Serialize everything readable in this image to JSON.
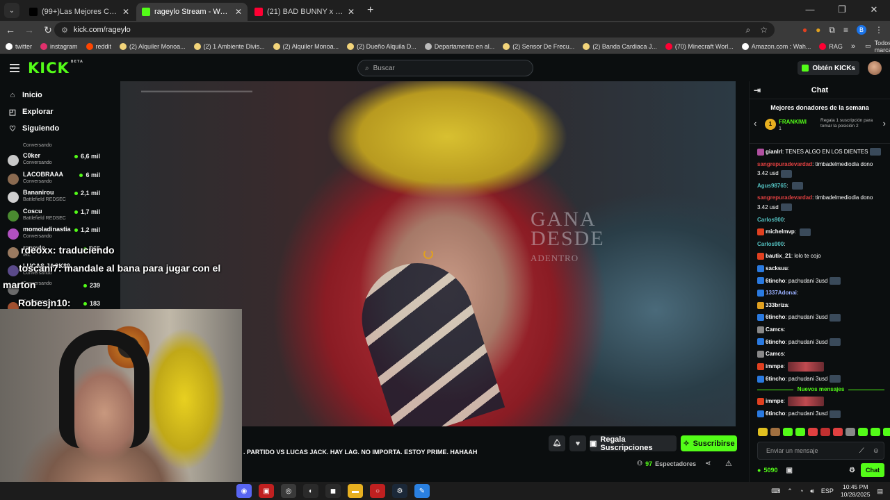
{
  "browser": {
    "tabs": [
      {
        "title": "(99+)Las Mejores Canciones Rá",
        "active": false,
        "favicon_color": "#000000"
      },
      {
        "title": "rageylo Stream - Watch Live",
        "active": true,
        "favicon_color": "#53fc18"
      },
      {
        "title": "(21) BAD BUNNY x JOWELL & R",
        "active": false,
        "favicon_color": "#ff0033"
      }
    ],
    "url": "kick.com/rageylo",
    "profile_initial": "B",
    "bookmarks": [
      {
        "label": "twitter",
        "color": "#ffffff"
      },
      {
        "label": "instagram",
        "color": "#e1306c"
      },
      {
        "label": "reddit",
        "color": "#ff4500"
      },
      {
        "label": "(2) Alquiler Monoa...",
        "color": "#f2d47a"
      },
      {
        "label": "(2) 1 Ambiente Divis...",
        "color": "#f2d47a"
      },
      {
        "label": "(2) Alquiler Monoa...",
        "color": "#f2d47a"
      },
      {
        "label": "(2) Dueño Alquila D...",
        "color": "#f2d47a"
      },
      {
        "label": "Departamento en al...",
        "color": "#bbbbbb"
      },
      {
        "label": "(2) Sensor De Frecu...",
        "color": "#f2d47a"
      },
      {
        "label": "(2) Banda Cardiaca J...",
        "color": "#f2d47a"
      },
      {
        "label": "(70) Minecraft Worl...",
        "color": "#ff0033"
      },
      {
        "label": "Amazon.com : Wah...",
        "color": "#ffffff"
      },
      {
        "label": "RAG",
        "color": "#ff0033"
      }
    ],
    "bookmarks_more": "»",
    "all_bookmarks": "Todos los marcadores"
  },
  "kick": {
    "logo": "KICK",
    "logo_sup": "BETA",
    "search_placeholder": "Buscar",
    "get_kicks": "Obtén KICKs",
    "accent": "#53fc18"
  },
  "sidebar": {
    "nav": [
      {
        "label": "Inicio",
        "icon": "home-icon",
        "glyph": "⌂"
      },
      {
        "label": "Explorar",
        "icon": "compass-icon",
        "glyph": "◰"
      },
      {
        "label": "Siguiendo",
        "icon": "heart-icon",
        "glyph": "♡"
      }
    ],
    "first_game": "Conversando",
    "channels": [
      {
        "name": "C0ker",
        "game": "Conversando",
        "viewers": "6,6 mil",
        "color": "#c8c8c8"
      },
      {
        "name": "LACOBRAAA",
        "game": "Conversando",
        "viewers": "6 mil",
        "color": "#8a6a50"
      },
      {
        "name": "Bananirou",
        "game": "Battlefield REDSEC",
        "viewers": "2,1 mil",
        "color": "#d0d0d0"
      },
      {
        "name": "Coscu",
        "game": "Battlefield REDSEC",
        "viewers": "1,7 mil",
        "color": "#4a8a30"
      },
      {
        "name": "momoladinastia",
        "game": "Conversando",
        "viewers": "1,2 mil",
        "color": "#b050c0"
      },
      {
        "name": "rageylo",
        "game": "IRL",
        "viewers": "965",
        "color": "#9a7a60"
      },
      {
        "name": "LUCAS JACK89",
        "game": "Conversando",
        "viewers": "",
        "color": "#5a4a8a"
      },
      {
        "name": "",
        "game": "Conversando",
        "viewers": "239",
        "color": "#6a6a6a"
      },
      {
        "name": "",
        "game": "Conversando",
        "viewers": "183",
        "color": "#a05030"
      }
    ]
  },
  "overlay": {
    "line1_user": "rdeoxx",
    "line1_text": ": traduciendo",
    "line2_user": "toscani7",
    "line2_text": ": mandale al bana para jugar con el",
    "line3": "marton",
    "line4_user": "Robesjn10",
    "line4_text": ":"
  },
  "stream": {
    "title": ". PARTIDO VS LUCAS JACK. HAY LAG. NO IMPORTA. ESTOY PRIME. HAHAAH",
    "gift_label": "Regala Suscripciones",
    "subscribe_label": "Suscribirse",
    "viewers": "97",
    "viewers_label": "Espectadores",
    "sign_line1": "GANA",
    "sign_line2": "DESDE",
    "sign_line3": "ADENTRO"
  },
  "chat": {
    "title": "Chat",
    "donors_title": "Mejores donadores de la semana",
    "top_donor": {
      "rank": "1",
      "name": "FRANKIWI",
      "count": "1"
    },
    "donor_cta": "Regala 1 suscripción para tomar la posición 2",
    "messages": [
      {
        "user": "gianlrl",
        "color": "#ffffff",
        "text": "TENES ALGO EN LOS DIENTES",
        "emote": "small",
        "badge": "#b050a0"
      },
      {
        "user": "sangrepuradevardad",
        "color": "#e04040",
        "text": "timbadelmediodia dono 3.42 usd",
        "emote": "small",
        "badge": ""
      },
      {
        "user": "Agus98765",
        "color": "#53c0c0",
        "text": "",
        "emote": "small",
        "badge": ""
      },
      {
        "user": "sangrepuradevardad",
        "color": "#e04040",
        "text": "timbadelmediodia dono 3.42 usd",
        "emote": "small",
        "badge": ""
      },
      {
        "user": "Carlos900",
        "color": "#53c0c0",
        "text": "",
        "emote": "",
        "badge": ""
      },
      {
        "user": "michelmvp",
        "color": "#ffffff",
        "text": "",
        "emote": "small",
        "badge": "#e04020"
      },
      {
        "user": "Carlos900",
        "color": "#53c0c0",
        "text": "",
        "emote": "",
        "badge": ""
      },
      {
        "user": "bautix_21",
        "color": "#ffffff",
        "text": "lolo te cojo",
        "emote": "",
        "badge": "#e04020"
      },
      {
        "user": "sacksuu",
        "color": "#ffffff",
        "text": "",
        "emote": "",
        "badge": "#2a7ae0"
      },
      {
        "user": "6tincho",
        "color": "#ffffff",
        "text": "pachudani 3usd",
        "emote": "small",
        "badge": "#2a7ae0"
      },
      {
        "user": "1337Adonai",
        "color": "#9ab0ff",
        "text": "",
        "emote": "",
        "badge": "#2a7ae0"
      },
      {
        "user": "333briza",
        "color": "#ffffff",
        "text": "",
        "emote": "",
        "badge": "#e0a020"
      },
      {
        "user": "6tincho",
        "color": "#ffffff",
        "text": "pachudani 3usd",
        "emote": "small",
        "badge": "#2a7ae0"
      },
      {
        "user": "Camcs",
        "color": "#ffffff",
        "text": "",
        "emote": "",
        "badge": "#888888"
      },
      {
        "user": "6tincho",
        "color": "#ffffff",
        "text": "pachudani 3usd",
        "emote": "small",
        "badge": "#2a7ae0"
      },
      {
        "user": "Camcs",
        "color": "#ffffff",
        "text": "",
        "emote": "",
        "badge": "#888888"
      },
      {
        "user": "immpe",
        "color": "#ffffff",
        "text": "",
        "emote": "wide",
        "badge": "#e04020"
      },
      {
        "user": "6tincho",
        "color": "#ffffff",
        "text": "pachudani 3usd",
        "emote": "small",
        "badge": "#2a7ae0"
      }
    ],
    "new_messages_label": "Nuevos mensajes",
    "new_messages": [
      {
        "user": "immpe",
        "color": "#ffffff",
        "text": "",
        "emote": "wide",
        "badge": "#e04020"
      },
      {
        "user": "6tincho",
        "color": "#ffffff",
        "text": "pachudani 3usd",
        "emote": "small",
        "badge": "#2a7ae0"
      }
    ],
    "emote_colors": [
      "#e0c020",
      "#a07040",
      "#53fc18",
      "#53fc18",
      "#e04040",
      "#c03030",
      "#e04040",
      "#888888",
      "#53fc18",
      "#53fc18",
      "#53fc18",
      "#53fc18",
      "#53fc18"
    ],
    "input_placeholder": "Enviar un mensaje",
    "kicks_balance": "5090",
    "send_label": "Chat"
  },
  "taskbar": {
    "apps": [
      {
        "name": "discord-icon",
        "glyph": "◉",
        "color": "#5865f2"
      },
      {
        "name": "app-icon",
        "glyph": "▣",
        "color": "#c02020"
      },
      {
        "name": "chrome-icon",
        "glyph": "◎",
        "color": "#3a3a3a"
      },
      {
        "name": "obs-icon",
        "glyph": "◐",
        "color": "#2a2a2a"
      },
      {
        "name": "capcut-icon",
        "glyph": "◼",
        "color": "#2a2a2a"
      },
      {
        "name": "explorer-icon",
        "glyph": "▬",
        "color": "#e8b020"
      },
      {
        "name": "opera-icon",
        "glyph": "○",
        "color": "#c02020"
      },
      {
        "name": "steam-icon",
        "glyph": "⚙",
        "color": "#1b2838"
      },
      {
        "name": "paint-icon",
        "glyph": "✎",
        "color": "#2a80e0"
      }
    ],
    "lang": "ESP",
    "time": "10:45 PM",
    "date": "10/28/2025"
  }
}
